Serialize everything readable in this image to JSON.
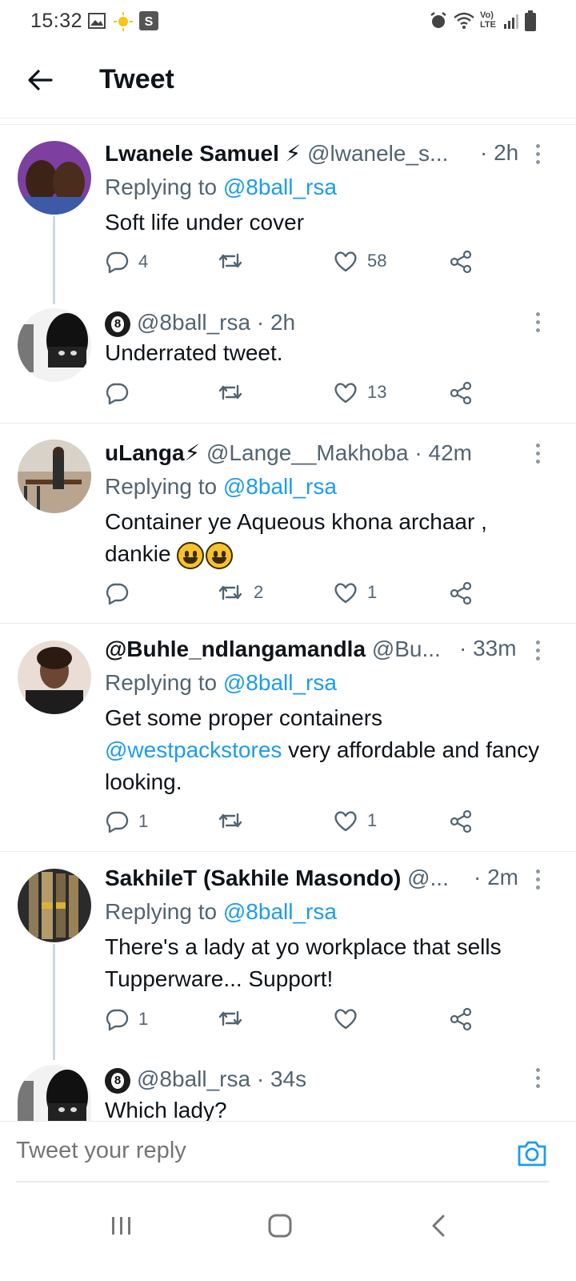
{
  "status_bar": {
    "time": "15:32",
    "network": "Vo) LTE"
  },
  "header": {
    "title": "Tweet"
  },
  "tweets": [
    {
      "name": "Lwanele Samuel ⚡",
      "handle": "@lwanele_s...",
      "time": "· 2h",
      "replying_prefix": "Replying to ",
      "replying_to": "@8ball_rsa",
      "text": "Soft life under cover",
      "replies": "4",
      "retweets": "",
      "likes": "58"
    },
    {
      "handle": "@8ball_rsa",
      "time": "· 2h",
      "text": "Underrated tweet.",
      "replies": "",
      "retweets": "",
      "likes": "13"
    },
    {
      "name": "uLanga⚡",
      "handle": "@Lange__Makhoba",
      "time": "· 42m",
      "replying_prefix": "Replying to ",
      "replying_to": "@8ball_rsa",
      "text": "Container ye Aqueous khona archaar , dankie",
      "replies": "",
      "retweets": "2",
      "likes": "1"
    },
    {
      "name": "@Buhle_ndlangamandla",
      "handle": "@Bu...",
      "time": "· 33m",
      "replying_prefix": "Replying to ",
      "replying_to": "@8ball_rsa",
      "text_pre": "Get some proper containers",
      "text_mention": "@westpackstores",
      "text_post": " very affordable and fancy looking.",
      "replies": "1",
      "retweets": "",
      "likes": "1"
    },
    {
      "name": "SakhileT (Sakhile Masondo)",
      "handle": "@...",
      "time": "· 2m",
      "replying_prefix": "Replying to ",
      "replying_to": "@8ball_rsa",
      "text": "There's a lady at yo workplace that sells Tupperware... Support!",
      "replies": "1",
      "retweets": "",
      "likes": ""
    },
    {
      "handle": "@8ball_rsa",
      "time": "· 34s",
      "text": "Which lady?"
    }
  ],
  "reply_bar": {
    "placeholder": "Tweet your reply"
  },
  "colors": {
    "accent": "#1d9bf0",
    "text": "#0f1419",
    "secondary": "#536471",
    "divider": "#e6ecf0"
  },
  "icons": [
    "back-arrow-icon",
    "reply-icon",
    "retweet-icon",
    "like-icon",
    "share-icon",
    "more-icon",
    "camera-icon",
    "recent-apps-icon",
    "home-icon",
    "nav-back-icon"
  ]
}
